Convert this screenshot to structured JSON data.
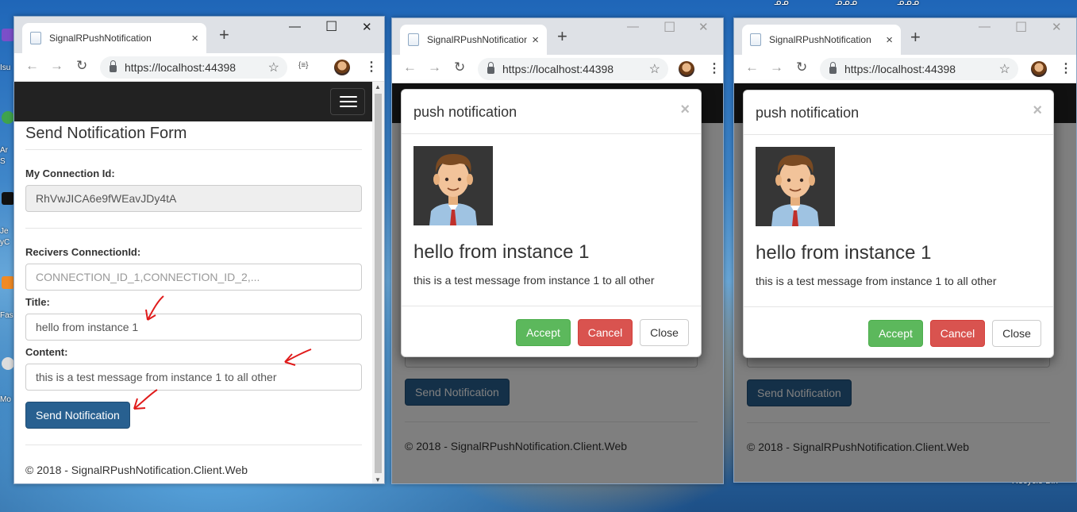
{
  "desktop": {
    "top_texts": [
      "ᓄᓄ",
      "ᓄᓄᓄ",
      "ᓄᓄᓄ"
    ],
    "left_labels": [
      "Isu",
      "Ar",
      "S",
      "Je",
      "yC",
      "Fas",
      "Mo"
    ],
    "recycle_label": "Recycle Bin"
  },
  "browser": {
    "tab_title": "SignalRPushNotification",
    "url": "https://localhost:44398",
    "new_tab_symbol": "+",
    "tab_close_symbol": "×",
    "minimize_symbol": "—",
    "maximize_symbol": "☐",
    "close_symbol": "✕",
    "back_symbol": "←",
    "forward_symbol": "→",
    "reload_symbol": "↻",
    "star_symbol": "☆",
    "ext_symbol": "{≡}",
    "kebab_symbol": "⋮"
  },
  "form": {
    "title": "Send Notification Form",
    "connection_label": "My Connection Id:",
    "connection_value": "RhVwJICA6e9fWEavJDy4tA",
    "receivers_label": "Recivers ConnectionId:",
    "receivers_placeholder": "CONNECTION_ID_1,CONNECTION_ID_2,...",
    "title_label": "Title:",
    "title_value": "hello from instance 1",
    "content_label": "Content:",
    "content_value": "this is a test message from  instance 1 to all other",
    "send_button": "Send Notification",
    "footer": "© 2018 - SignalRPushNotification.Client.Web"
  },
  "modal": {
    "title": "push notification",
    "close_x": "×",
    "heading": "hello from instance 1",
    "message": "this is a test message from instance 1 to all other",
    "accept": "Accept",
    "cancel": "Cancel",
    "close": "Close"
  },
  "colors": {
    "accept": "#5cb85c",
    "cancel": "#d9534f",
    "primary": "#286090",
    "navbar": "#222222",
    "annotation_arrow": "#e01b1b"
  }
}
